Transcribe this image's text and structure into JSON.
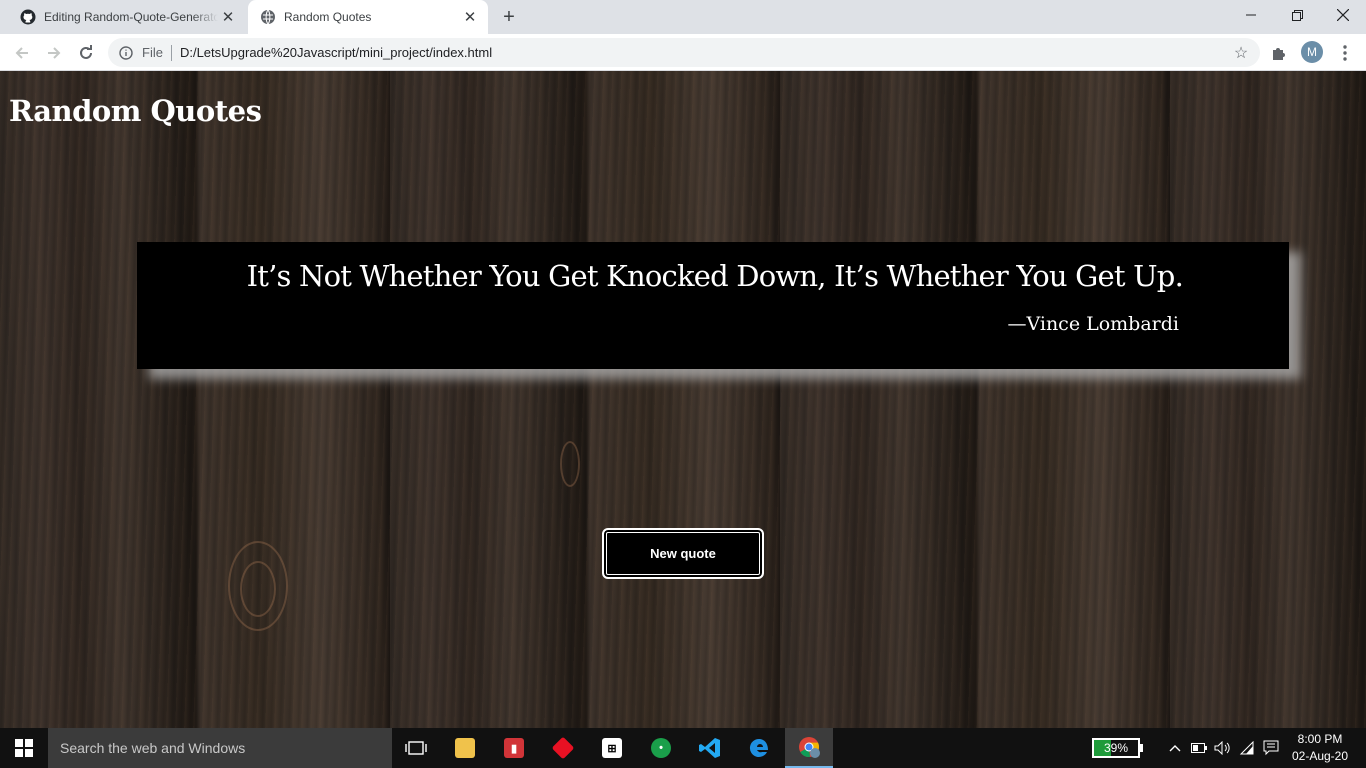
{
  "browser": {
    "tabs": [
      {
        "title": "Editing Random-Quote-Generator",
        "favicon": "github-icon",
        "active": false
      },
      {
        "title": "Random Quotes",
        "favicon": "globe-icon",
        "active": true
      }
    ],
    "new_tab_glyph": "+",
    "window_controls": {
      "minimize": "—",
      "maximize": "❐",
      "close": "✕"
    },
    "toolbar": {
      "url_scheme": "File",
      "url": "D:/LetsUpgrade%20Javascript/mini_project/index.html",
      "profile_initial": "M"
    }
  },
  "page": {
    "heading": "Random Quotes",
    "quote": {
      "text": "It’s Not Whether You Get Knocked Down, It’s Whether You Get Up.",
      "author": "—Vince Lombardi"
    },
    "button_label": "New quote"
  },
  "taskbar": {
    "search_placeholder": "Search the web and Windows",
    "battery_percent": "39%",
    "battery_level": 0.39,
    "time": "8:00 PM",
    "date": "02-Aug-20"
  },
  "colors": {
    "quote_box_bg": "#000000",
    "battery_fill": "#1e9b3a",
    "active_underline": "#76b9ed"
  }
}
